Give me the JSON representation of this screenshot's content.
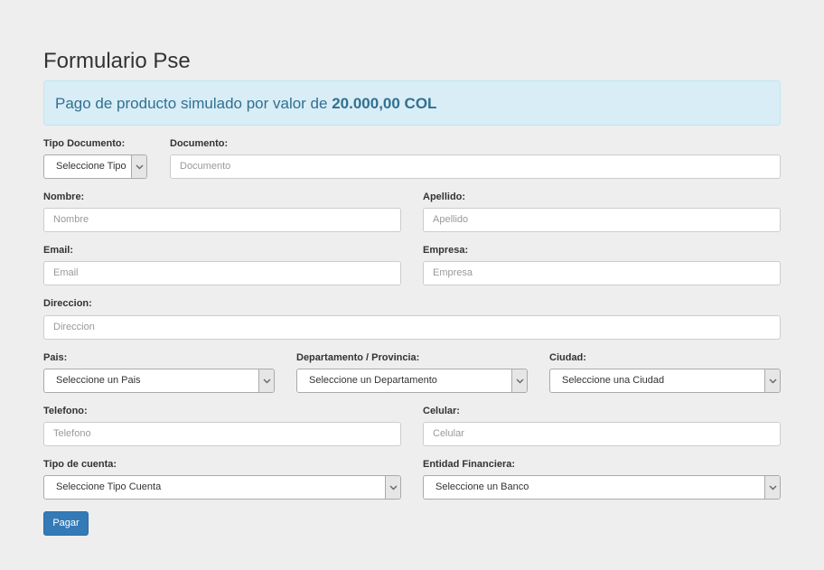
{
  "title": "Formulario Pse",
  "alert": {
    "prefix": "Pago de producto simulado por valor de ",
    "amount": "20.000,00 COL"
  },
  "fields": {
    "tipo_documento": {
      "label": "Tipo Documento:",
      "value": "Seleccione Tipo"
    },
    "documento": {
      "label": "Documento:",
      "placeholder": "Documento"
    },
    "nombre": {
      "label": "Nombre:",
      "placeholder": "Nombre"
    },
    "apellido": {
      "label": "Apellido:",
      "placeholder": "Apellido"
    },
    "email": {
      "label": "Email:",
      "placeholder": "Email"
    },
    "empresa": {
      "label": "Empresa:",
      "placeholder": "Empresa"
    },
    "direccion": {
      "label": "Direccion:",
      "placeholder": "Direccion"
    },
    "pais": {
      "label": "Pais:",
      "value": "Seleccione un Pais"
    },
    "departamento": {
      "label": "Departamento / Provincia:",
      "value": "Seleccione un Departamento"
    },
    "ciudad": {
      "label": "Ciudad:",
      "value": "Seleccione una Ciudad"
    },
    "telefono": {
      "label": "Telefono:",
      "placeholder": "Telefono"
    },
    "celular": {
      "label": "Celular:",
      "placeholder": "Celular"
    },
    "tipo_cuenta": {
      "label": "Tipo de cuenta:",
      "value": "Seleccione Tipo Cuenta"
    },
    "entidad": {
      "label": "Entidad Financiera:",
      "value": "Seleccione un Banco"
    }
  },
  "submit_label": "Pagar",
  "colors": {
    "accent": "#337ab7",
    "alert_bg": "#d9edf7",
    "alert_text": "#31708f"
  },
  "icons": {
    "select_arrow": "chevron-down-icon"
  }
}
